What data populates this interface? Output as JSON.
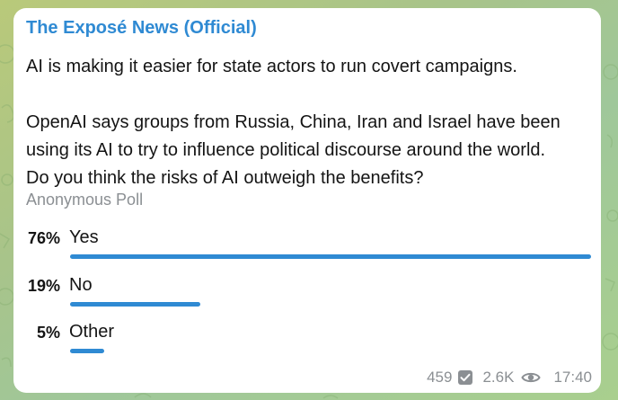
{
  "channel": {
    "name": "The Exposé News (Official)"
  },
  "message": {
    "line1": "AI is making it easier for state actors to run covert campaigns.",
    "line2": "OpenAI says groups from Russia, China, Iran and Israel have been",
    "line3": "using its AI to try to influence political discourse around the world.",
    "line4": "Do you think the risks of AI outweigh the benefits?"
  },
  "poll": {
    "type": "Anonymous Poll",
    "options": [
      {
        "percent": "76%",
        "label": "Yes",
        "fraction": 0.76
      },
      {
        "percent": "19%",
        "label": "No",
        "fraction": 0.19
      },
      {
        "percent": "5%",
        "label": "Other",
        "fraction": 0.05
      }
    ]
  },
  "meta": {
    "votes": "459",
    "views": "2.6K",
    "time": "17:40"
  },
  "colors": {
    "accent": "#2f8ad3",
    "text": "#141414",
    "muted": "#8b8f93"
  },
  "icons": {
    "votes": "checkbox-icon",
    "views": "eye-icon"
  }
}
